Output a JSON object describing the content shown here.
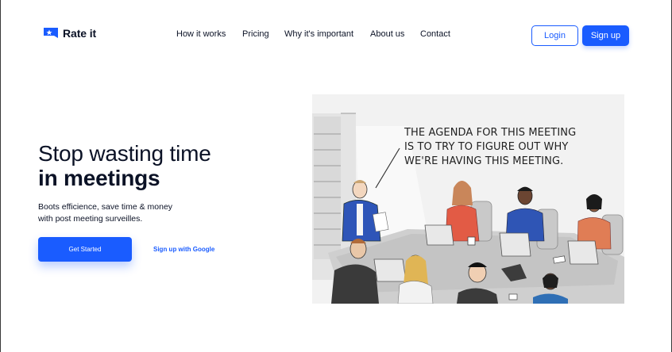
{
  "brand": {
    "name": "Rate it",
    "accent_color": "#1a5cff",
    "logo_icon": "flag-star-icon"
  },
  "nav": {
    "items": [
      {
        "label": "How it works"
      },
      {
        "label": "Pricing"
      },
      {
        "label": "Why it's important"
      },
      {
        "label": "About us"
      },
      {
        "label": "Contact"
      }
    ]
  },
  "auth": {
    "login_label": "Login",
    "signup_label": "Sign up"
  },
  "hero": {
    "title_line1": "Stop wasting time",
    "title_line2": "in meetings",
    "subtitle_line1": "Boots efficience, save time & money",
    "subtitle_line2": "with post meeting surveilles.",
    "cta_label": "Get Started",
    "google_label": "Sign up with Google"
  },
  "cartoon": {
    "caption_line1": "THE AGENDA FOR THIS MEETING",
    "caption_line2": "IS TO TRY TO FIGURE OUT WHY",
    "caption_line3": "WE'RE HAVING THIS MEETING."
  }
}
